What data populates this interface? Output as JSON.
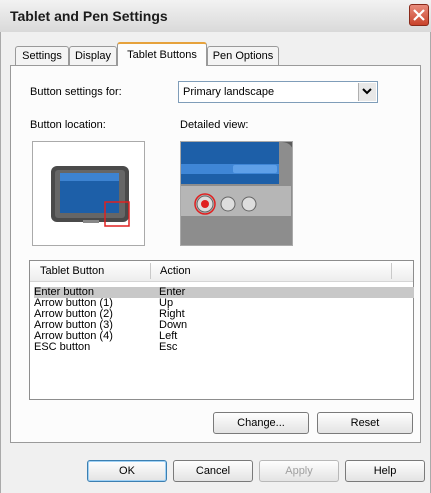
{
  "window": {
    "title": "Tablet and Pen Settings"
  },
  "tabs": [
    {
      "label": "Settings"
    },
    {
      "label": "Display"
    },
    {
      "label": "Tablet Buttons",
      "active": true
    },
    {
      "label": "Pen Options"
    }
  ],
  "form": {
    "button_settings_label": "Button settings for:",
    "button_settings_value": "Primary landscape",
    "button_location_label": "Button location:",
    "detailed_view_label": "Detailed view:"
  },
  "table": {
    "headers": [
      "Tablet Button",
      "Action"
    ],
    "rows": [
      {
        "button": "Enter button",
        "action": "Enter",
        "selected": true
      },
      {
        "button": "Arrow button (1)",
        "action": "Up"
      },
      {
        "button": "Arrow button (2)",
        "action": "Right"
      },
      {
        "button": "Arrow button (3)",
        "action": "Down"
      },
      {
        "button": "Arrow button (4)",
        "action": "Left"
      },
      {
        "button": "ESC button",
        "action": "Esc"
      }
    ]
  },
  "buttons": {
    "change": "Change...",
    "reset": "Reset",
    "ok": "OK",
    "cancel": "Cancel",
    "apply": "Apply",
    "help": "Help"
  },
  "colors": {
    "selection": "#c8c8c8",
    "highlight_box": "#e02020",
    "active_tab_accent": "#e6a23c"
  }
}
